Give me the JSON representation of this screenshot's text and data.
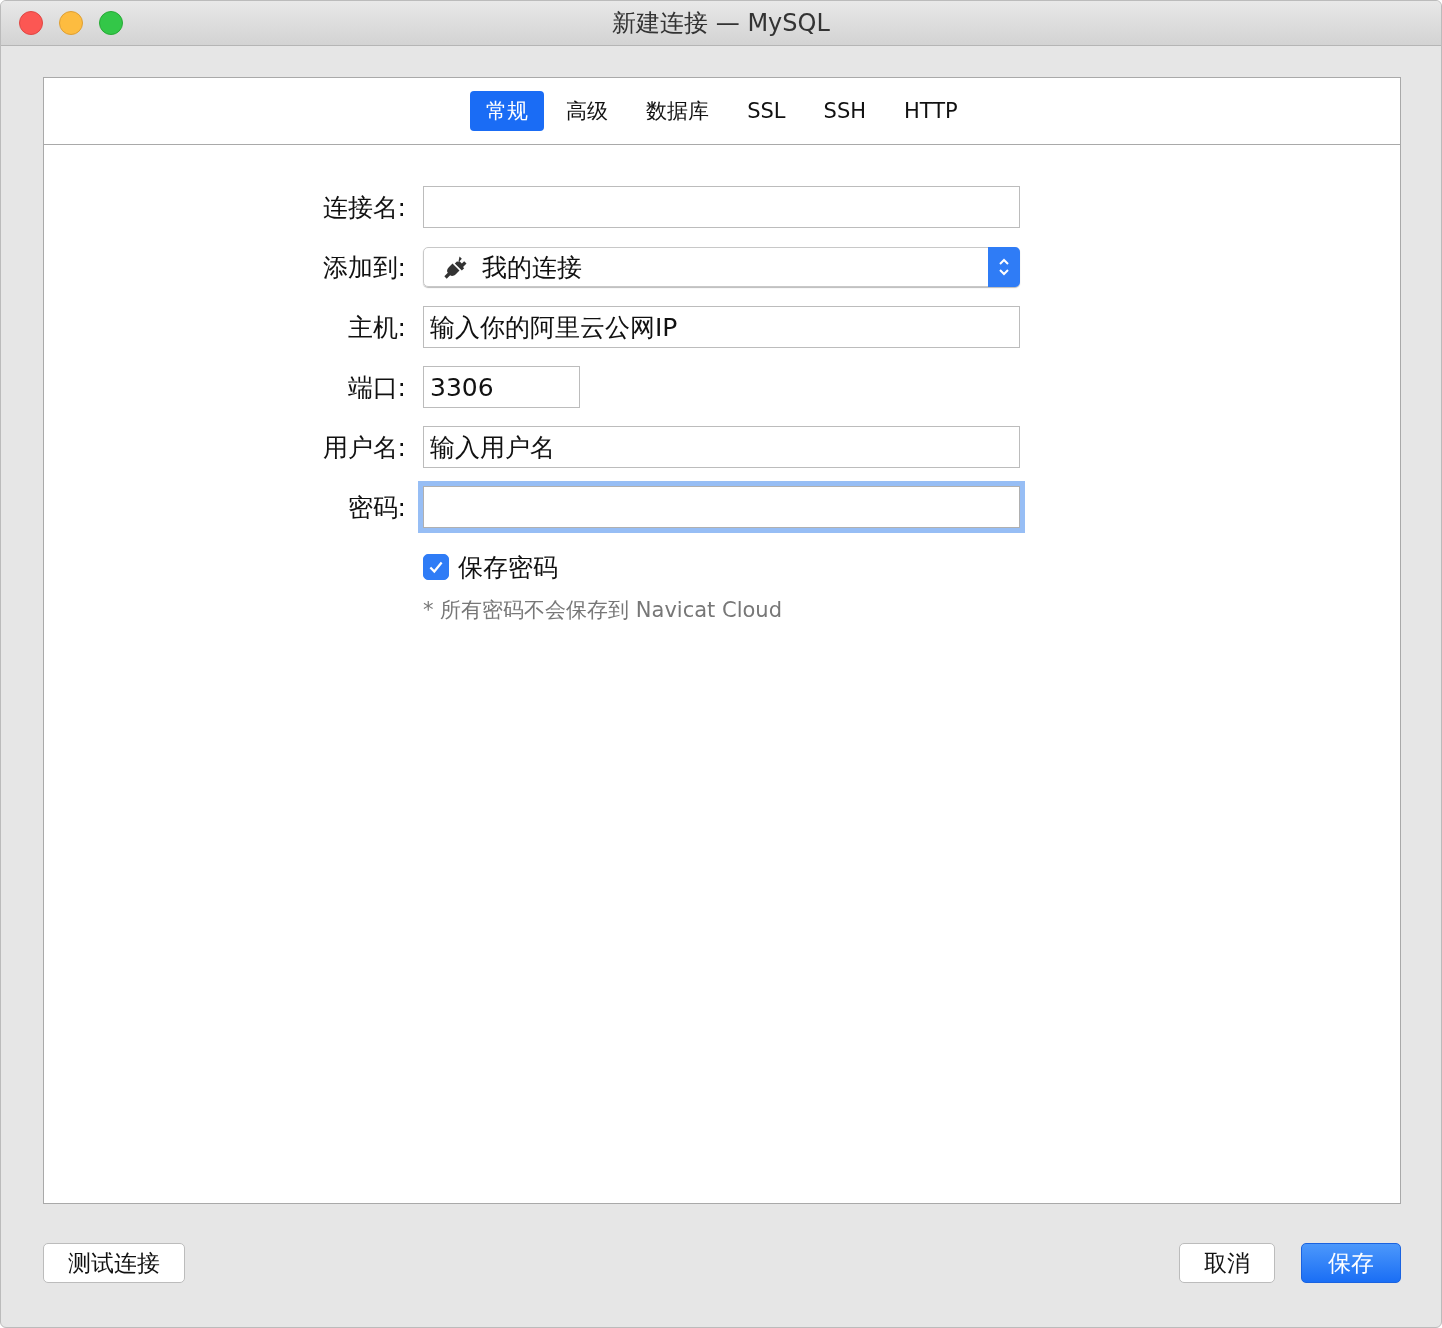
{
  "window": {
    "title": "新建连接 — MySQL"
  },
  "tabs": [
    {
      "label": "常规",
      "selected": true
    },
    {
      "label": "高级",
      "selected": false
    },
    {
      "label": "数据库",
      "selected": false
    },
    {
      "label": "SSL",
      "selected": false
    },
    {
      "label": "SSH",
      "selected": false
    },
    {
      "label": "HTTP",
      "selected": false
    }
  ],
  "fields": [
    {
      "kind": "text",
      "label": "连接名:",
      "focused": false
    },
    {
      "kind": "select",
      "label": "添加到:",
      "value": "我的连接",
      "focused": false
    },
    {
      "kind": "text",
      "label": "主机:",
      "value": "输入你的阿里云公网IP",
      "focused": false
    },
    {
      "kind": "number",
      "label": "端口:",
      "value": "3306",
      "focused": false
    },
    {
      "kind": "text",
      "label": "用户名:",
      "value": "输入用户名",
      "focused": false
    },
    {
      "kind": "text",
      "label": "密码:",
      "focused": true
    }
  ],
  "save_password": {
    "label": "保存密码",
    "checked": true
  },
  "note": "* 所有密码不会保存到 Navicat Cloud",
  "buttons": [
    {
      "label": "测试连接",
      "kind": "default"
    },
    {
      "label": "取消",
      "kind": "default"
    },
    {
      "label": "保存",
      "kind": "primary"
    }
  ]
}
